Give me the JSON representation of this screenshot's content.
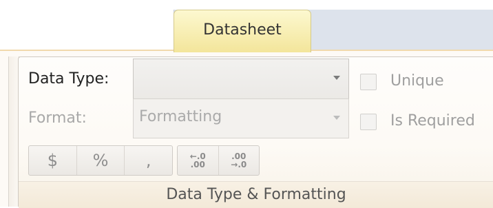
{
  "ribbon": {
    "active_tab": "Datasheet",
    "group": {
      "title": "Data Type & Formatting",
      "data_type": {
        "label": "Data Type:",
        "value": ""
      },
      "format": {
        "label": "Format:",
        "value": "Formatting"
      },
      "unique": {
        "label": "Unique",
        "checked": false
      },
      "is_required": {
        "label": "Is Required",
        "checked": false
      },
      "number_buttons": [
        "$",
        "%",
        ","
      ],
      "decimal_buttons": [
        {
          "name": "increase-decimals",
          "top": "←.0",
          "bottom": ".00"
        },
        {
          "name": "decrease-decimals",
          "top": ".00",
          "bottom": "→.0"
        }
      ]
    }
  }
}
